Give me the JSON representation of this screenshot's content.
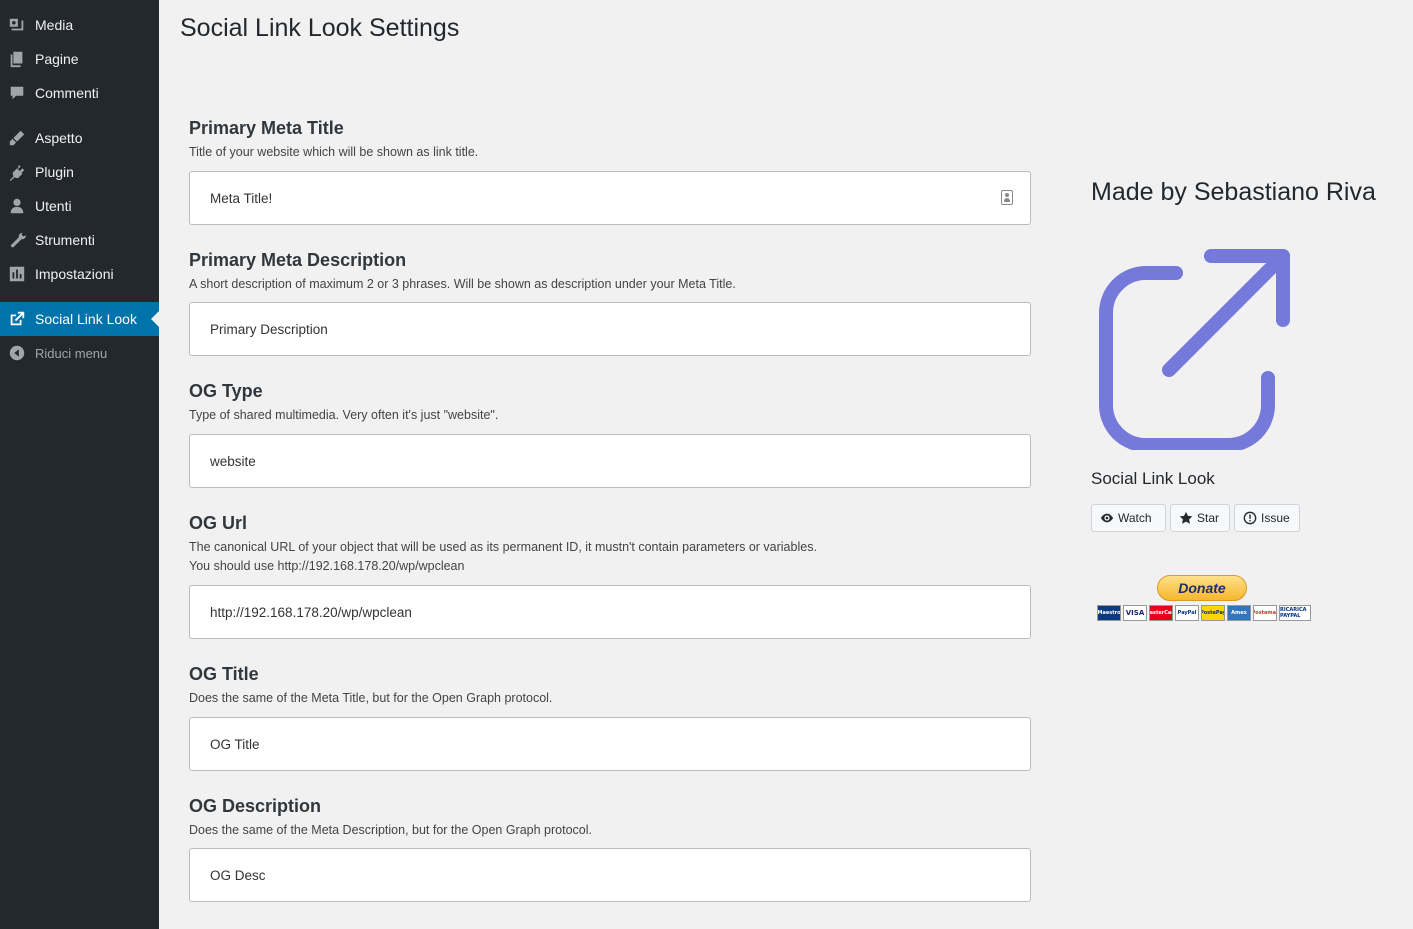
{
  "sidebar": {
    "items": [
      {
        "label": "Media",
        "icon": "media-icon"
      },
      {
        "label": "Pagine",
        "icon": "pages-icon"
      },
      {
        "label": "Commenti",
        "icon": "comments-icon"
      },
      {
        "label": "Aspetto",
        "icon": "appearance-icon"
      },
      {
        "label": "Plugin",
        "icon": "plugin-icon"
      },
      {
        "label": "Utenti",
        "icon": "users-icon"
      },
      {
        "label": "Strumenti",
        "icon": "tools-icon"
      },
      {
        "label": "Impostazioni",
        "icon": "settings-icon"
      },
      {
        "label": "Social Link Look",
        "icon": "external-link-icon",
        "active": true
      },
      {
        "label": "Riduci menu",
        "icon": "collapse-icon"
      }
    ]
  },
  "page": {
    "title": "Social Link Look Settings"
  },
  "fields": [
    {
      "label": "Primary Meta Title",
      "description": "Title of your website which will be shown as link title.",
      "value": "Meta Title!"
    },
    {
      "label": "Primary Meta Description",
      "description": "A short description of maximum 2 or 3 phrases. Will be shown as description under your Meta Title.",
      "value": "Primary Description"
    },
    {
      "label": "OG Type",
      "description": "Type of shared multimedia. Very often it's just \"website\".",
      "value": "website"
    },
    {
      "label": "OG Url",
      "description": "The canonical URL of your object that will be used as its permanent ID, it mustn't contain parameters or variables.",
      "description2": "You should use http://192.168.178.20/wp/wpclean",
      "value": "http://192.168.178.20/wp/wpclean"
    },
    {
      "label": "OG Title",
      "description": "Does the same of the Meta Title, but for the Open Graph protocol.",
      "value": "OG Title"
    },
    {
      "label": "OG Description",
      "description": "Does the same of the Meta Description, but for the Open Graph protocol.",
      "value": "OG Desc"
    }
  ],
  "panel": {
    "made_by": "Made by Sebastiano Riva",
    "repo_name": "Social Link Look",
    "icon_color": "#7579d9",
    "buttons": {
      "watch": "Watch",
      "star": "Star",
      "issue": "Issue"
    },
    "donate": "Donate",
    "cards": [
      "Maestro",
      "VISA",
      "MasterCard",
      "PayPal",
      "PostePay",
      "Amex",
      "Postamat",
      "RICARICA PAYPAL"
    ]
  },
  "colors": {
    "sidebar_bg": "#23282d",
    "active_bg": "#0073aa",
    "page_bg": "#f1f1f1"
  }
}
